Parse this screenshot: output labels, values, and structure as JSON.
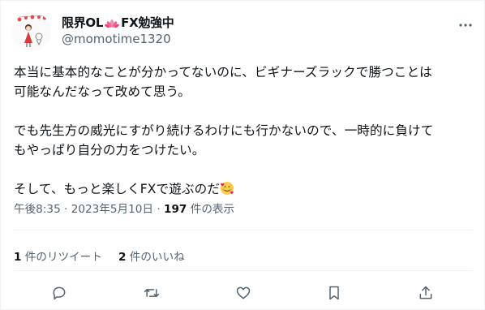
{
  "author": {
    "display_name": "限界OL",
    "name_emoji": "lotus-icon",
    "name_suffix": "FX勉強中",
    "handle": "@momotime1320"
  },
  "tweet": {
    "line1": "本当に基本的なことが分かってないのに、ビギナーズラックで勝つことは",
    "line2": "可能なんだなって改めて思う。",
    "line3": "でも先生方の威光にすがり続けるわけにも行かないので、一時的に負けて",
    "line4": "もやっぱり自分の力をつけたい。",
    "line5": "そして、もっと楽しくFXで遊ぶのだ",
    "line5_emoji": "smiling-face-with-hearts-icon"
  },
  "meta": {
    "time": "午後8:35",
    "separator": "·",
    "date": "2023年5月10日",
    "view_count": "197",
    "view_label": "件の表示"
  },
  "stats": {
    "retweet_count": "1",
    "retweet_label": "件のリツイート",
    "like_count": "2",
    "like_label": "件のいいね"
  },
  "colors": {
    "text": "#0f1419",
    "secondary": "#536471",
    "divider": "#eff3f4"
  }
}
